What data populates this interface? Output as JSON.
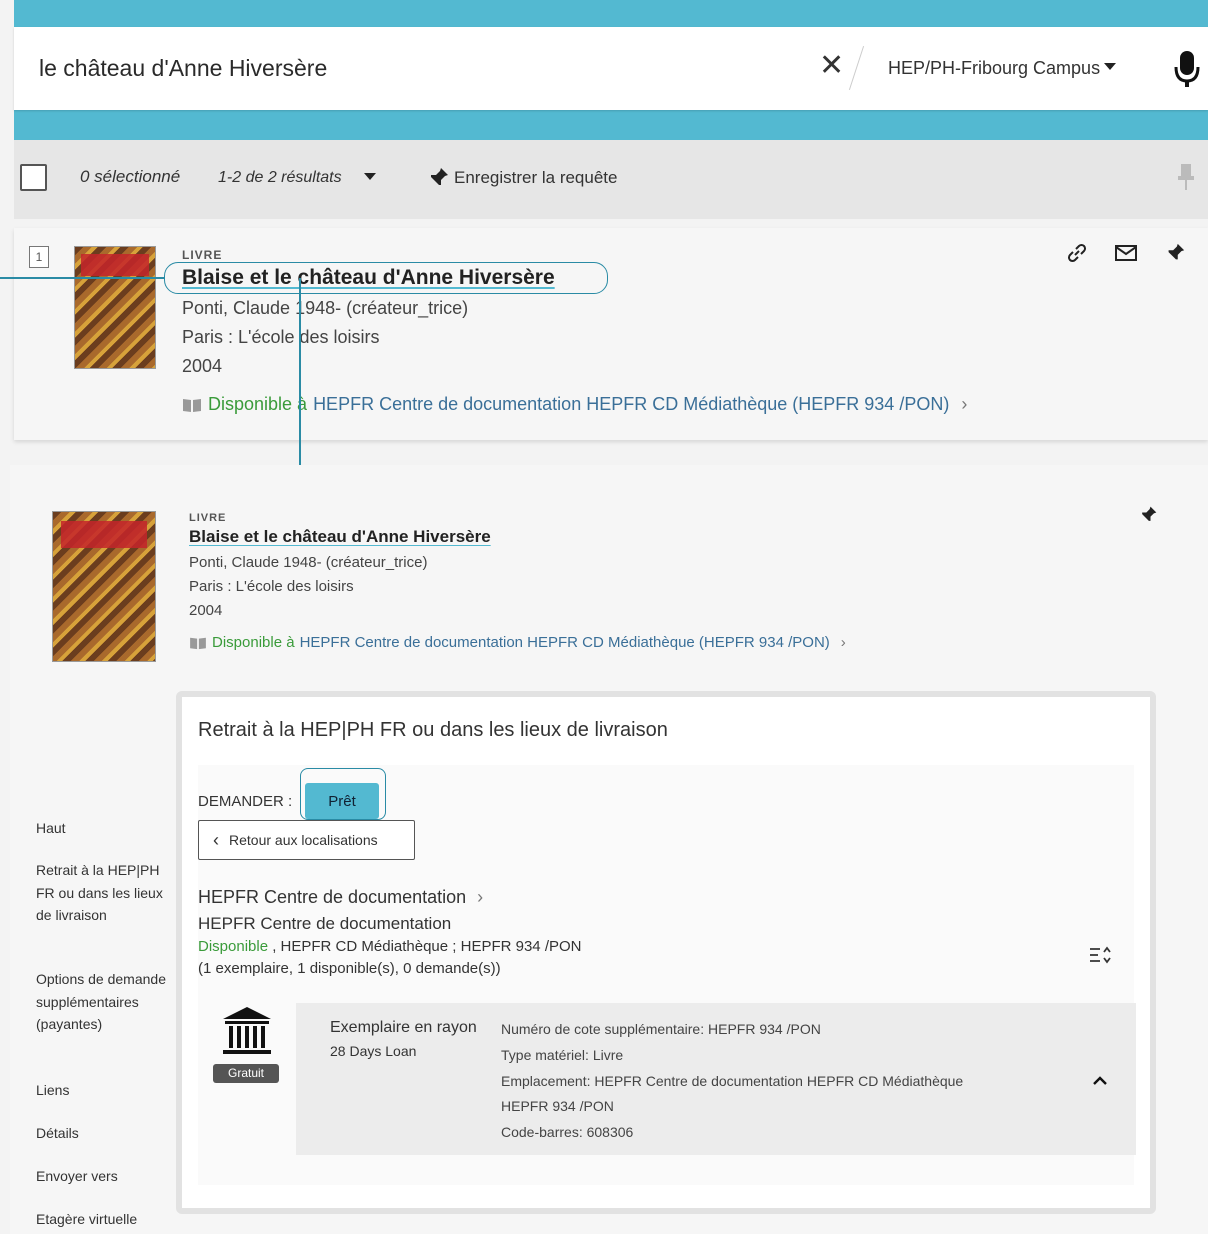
{
  "search": {
    "query": "le château d'Anne Hiversère",
    "scope": "HEP/PH-Fribourg Campus"
  },
  "results_bar": {
    "selected": "0 sélectionné",
    "count": "1-2 de 2 résultats",
    "save_query": "Enregistrer la requête"
  },
  "record1": {
    "number": "1",
    "type": "LIVRE",
    "title": "Blaise et le château d'Anne Hiversère",
    "author": "Ponti, Claude 1948- (créateur_trice)",
    "publisher": "Paris : L'école des loisirs",
    "year": "2004",
    "availability": "Disponible à",
    "location": "HEPFR Centre de documentation  HEPFR CD Médiathèque (HEPFR 934 /PON)"
  },
  "record2": {
    "type": "LIVRE",
    "title": "Blaise et le château d'Anne Hiversère",
    "author": "Ponti, Claude 1948- (créateur_trice)",
    "publisher": "Paris : L'école des loisirs",
    "year": "2004",
    "availability": "Disponible à",
    "location": "HEPFR Centre de documentation  HEPFR CD Médiathèque (HEPFR 934 /PON)"
  },
  "sidenav": {
    "items": [
      "Haut",
      "Retrait à la HEP|PH FR ou dans les lieux de livraison",
      "Options de demande supplémentaires (payantes)",
      "Liens",
      "Détails",
      "Envoyer vers",
      "Etagère virtuelle"
    ]
  },
  "panel": {
    "title": "Retrait à la HEP|PH FR ou dans les lieux de livraison",
    "request_label": "DEMANDER :",
    "request_button": "Prêt",
    "back_button": "Retour aux localisations",
    "location_name": "HEPFR Centre de documentation",
    "location_sub": "HEPFR Centre de documentation",
    "status_available": "Disponible",
    "status_detail": " , HEPFR CD Médiathèque ; HEPFR 934 /PON",
    "counts": "(1 exemplaire, 1 disponible(s), 0 demande(s))",
    "item": {
      "badge": "Gratuit",
      "type": "Exemplaire en rayon",
      "loan": "28 Days Loan",
      "lines": [
        "Numéro de cote supplémentaire: HEPFR 934 /PON",
        "Type matériel: Livre",
        "Emplacement: HEPFR Centre de documentation HEPFR CD Médiathèque",
        "HEPFR 934 /PON",
        "Code-barres: 608306"
      ]
    }
  },
  "colors": {
    "accent": "#53b9d1",
    "available": "#3a9b3a",
    "link": "#3a6f98"
  }
}
